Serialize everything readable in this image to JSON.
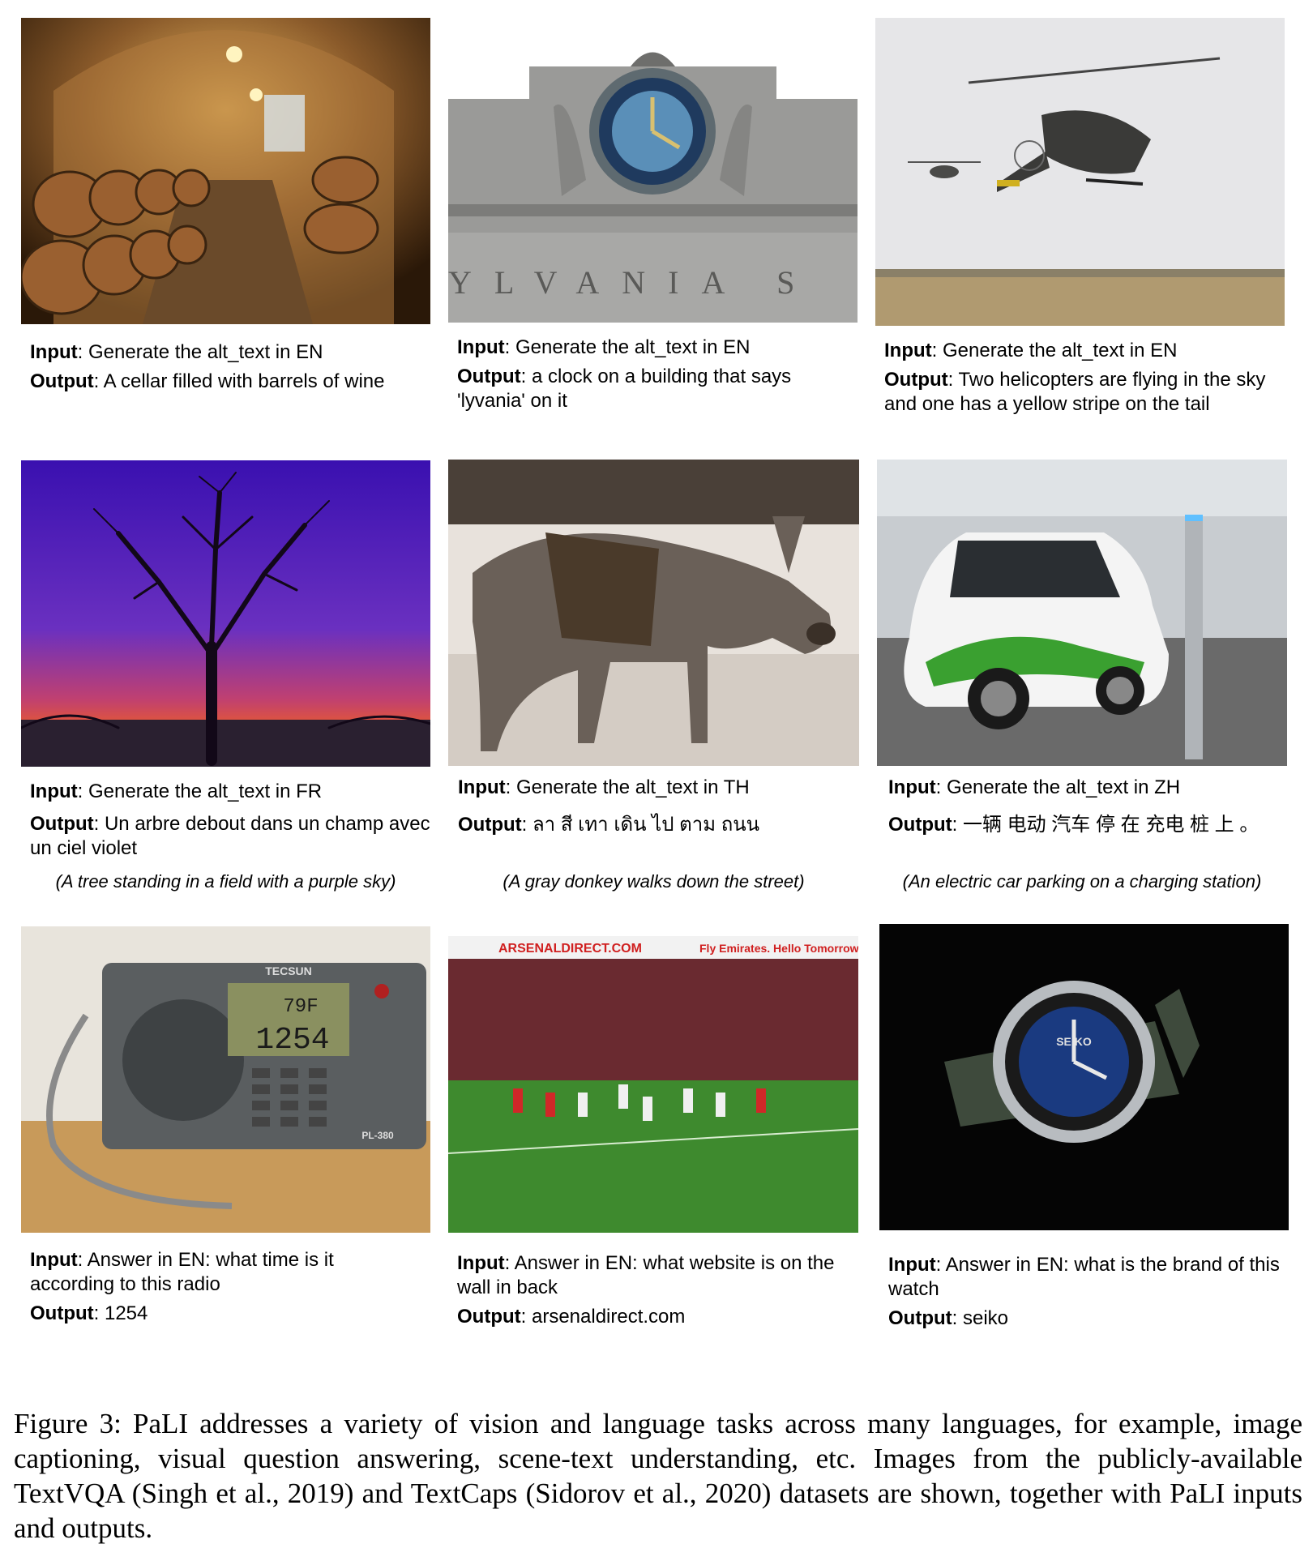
{
  "panels": [
    {
      "id": "cellar",
      "image_subject": "wine-cellar-photo",
      "image_text": "",
      "input_label": "Input",
      "input_text": ": Generate the alt_text in EN",
      "output_label": "Output",
      "output_text": ": A cellar filled with barrels of wine",
      "translation": ""
    },
    {
      "id": "clock",
      "image_subject": "building-clock-photo",
      "image_text": "YLVANIA S",
      "input_label": "Input",
      "input_text": ": Generate the alt_text in EN",
      "output_label": "Output",
      "output_text": ": a clock on a building that says 'lyvania' on it",
      "translation": ""
    },
    {
      "id": "helicopter",
      "image_subject": "helicopters-photo",
      "image_text": "",
      "input_label": "Input",
      "input_text": ": Generate the alt_text in EN",
      "output_label": "Output",
      "output_text": ": Two helicopters are flying in the sky and one has a yellow stripe on the tail",
      "translation": ""
    },
    {
      "id": "tree",
      "image_subject": "tree-sunset-photo",
      "image_text": "",
      "input_label": "Input",
      "input_text": ": Generate the alt_text in FR",
      "output_label": "Output",
      "output_text": ": Un arbre debout dans un champ avec un ciel violet",
      "translation": "(A tree standing in a field with a purple sky)"
    },
    {
      "id": "donkey",
      "image_subject": "donkey-photo",
      "image_text": "",
      "input_label": "Input",
      "input_text": ": Generate the alt_text in TH",
      "output_label": "Output",
      "output_text": ": ลา สี เทา เดิน ไป ตาม ถนน",
      "translation": "(A gray donkey walks down the street)"
    },
    {
      "id": "car",
      "image_subject": "electric-car-photo",
      "image_text": "",
      "input_label": "Input",
      "input_text": ": Generate the alt_text in ZH",
      "output_label": "Output",
      "output_text": ": 一辆 电动 汽车 停 在 充电 桩 上 。",
      "translation": "(An electric car parking on a charging station)"
    },
    {
      "id": "radio",
      "image_subject": "radio-photo",
      "image_text": "TECSUN 79F 1254 PL-380",
      "input_label": "Input",
      "input_text": ": Answer in EN: what time is it according to this radio",
      "output_label": "Output",
      "output_text": ": 1254",
      "translation": ""
    },
    {
      "id": "soccer",
      "image_subject": "soccer-match-photo",
      "image_text": "ARSENALDIRECT.COM Fly Emirates. Hello Tomorrow",
      "input_label": "Input",
      "input_text": ": Answer in EN: what website is on the wall in back",
      "output_label": "Output",
      "output_text": ": arsenaldirect.com",
      "translation": ""
    },
    {
      "id": "watch",
      "image_subject": "watch-photo",
      "image_text": "SEIKO",
      "input_label": "Input",
      "input_text": ": Answer in EN: what is the brand of this watch",
      "output_label": "Output",
      "output_text": ": seiko",
      "translation": ""
    }
  ],
  "figure_caption": "Figure 3: PaLI addresses a variety of vision and language tasks across many languages, for example, image captioning, visual question answering, scene-text understanding, etc. Images from the publicly-available TextVQA (Singh et al., 2019) and TextCaps (Sidorov et al., 2020) datasets are shown, together with PaLI inputs and outputs."
}
